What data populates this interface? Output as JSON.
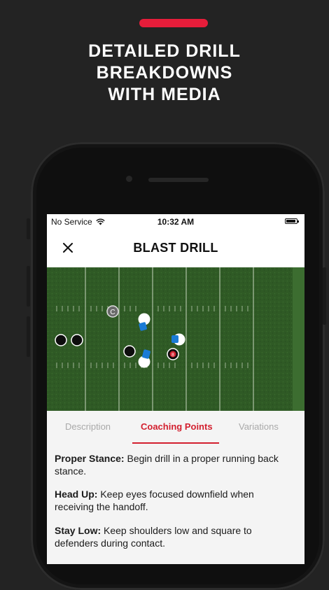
{
  "promo": {
    "headline_lines": [
      "DETAILED DRILL",
      "BREAKDOWNS",
      "WITH MEDIA"
    ],
    "accent_color": "#e61d3a"
  },
  "status_bar": {
    "carrier": "No Service",
    "wifi_icon": "wifi-icon",
    "time": "10:32 AM",
    "battery_icon": "battery-icon"
  },
  "nav": {
    "close_icon": "close-icon",
    "title": "BLAST DRILL"
  },
  "field": {
    "turf_color": "#2f5a25",
    "player_label": "C",
    "ball_label": "8"
  },
  "tabs": [
    {
      "label": "Description",
      "active": false
    },
    {
      "label": "Coaching Points",
      "active": true
    },
    {
      "label": "Variations",
      "active": false
    }
  ],
  "coaching_points": [
    {
      "title": "Proper Stance:",
      "text": " Begin drill in a proper running back stance."
    },
    {
      "title": "Head Up:",
      "text": " Keep eyes focused downfield when receiving the handoff."
    },
    {
      "title": "Stay Low:",
      "text": " Keep shoulders low and square to defenders during contact."
    }
  ]
}
